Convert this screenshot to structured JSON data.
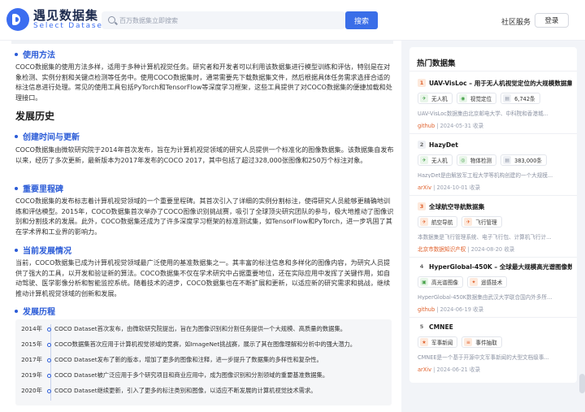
{
  "header": {
    "logo_cn": "遇见数据集",
    "logo_en": "Select Dataset",
    "search_placeholder": "百万数据集立即搜索",
    "search_button": "搜索",
    "community": "社区服务",
    "login": "登录"
  },
  "main": {
    "usage_heading": "使用方法",
    "usage_text": "COCO数据集的使用方法多样，适用于多种计算机视觉任务。研究者和开发者可以利用该数据集进行模型训练和评估，特别是在对象检测、实例分割和关键点检测等任务中。使用COCO数据集时，通常需要先下载数据集文件，然后根据具体任务需求选择合适的标注信息进行处理。常见的使用工具包括PyTorch和TensorFlow等深度学习框架，这些工具提供了对COCO数据集的便捷加载和处理接口。",
    "history_heading": "发展历史",
    "creation_heading": "创建时间与更新",
    "creation_text": "COCO数据集由微软研究院于2014年首次发布，旨在为计算机视觉领域的研究人员提供一个标准化的图像数据集。该数据集自发布以来，经历了多次更新，最新版本为2017年发布的COCO 2017，其中包括了超过328,000张图像和250万个标注对象。",
    "milestone_heading": "重要里程碑",
    "milestone_text": "COCO数据集的发布标志着计算机视觉领域的一个重要里程碑。其首次引入了详细的实例分割标注，使得研究人员能够更精确地训练和评估模型。2015年，COCO数据集首次举办了COCO图像识别挑战赛，吸引了全球顶尖研究团队的参与，极大地推动了图像识别和分割技术的发展。此外，COCO数据集还成为了许多深度学习框架的标准测试集，如TensorFlow和PyTorch，进一步巩固了其在学术界和工业界的影响力。",
    "current_heading": "当前发展情况",
    "current_text": "当前，COCO数据集已成为计算机视觉领域最广泛使用的基准数据集之一。其丰富的标注信息和多样化的图像内容，为研究人员提供了强大的工具，以开发和验证新的算法。COCO数据集不仅在学术研究中占据重要地位，还在实际应用中发挥了关键作用，如自动驾驶、医学影像分析和智能监控系统。随着技术的进步，COCO数据集也在不断扩展和更新，以适应新的研究需求和挑战，继续推动计算机视觉领域的创新和发展。",
    "timeline_heading": "发展历程",
    "timeline": [
      {
        "year": "2014年",
        "text": "COCO Dataset首次发布，由微软研究院提出，旨在为图像识别和分割任务提供一个大规模、高质量的数据集。"
      },
      {
        "year": "2015年",
        "text": "COCO数据集首次应用于计算机视觉领域的竞赛，如ImageNet挑战赛，展示了其在图像理解和分析中的强大潜力。"
      },
      {
        "year": "2017年",
        "text": "COCO Dataset发布了新的版本，增加了更多的图像和注释，进一步提升了数据集的多样性和复杂性。"
      },
      {
        "year": "2019年",
        "text": "COCO Dataset被广泛应用于多个研究项目和商业应用中，成为图像识别和分割领域的重要基准数据集。"
      },
      {
        "year": "2020年",
        "text": "COCO Dataset继续更新，引入了更多的标注类别和图像，以适应不断发展的计算机视觉技术需求。"
      }
    ]
  },
  "sidebar": {
    "title": "热门数据集",
    "items": [
      {
        "rank": "1",
        "rank_bg": "#fde9dc",
        "rank_fg": "#e0602b",
        "title": "UAV-VisLoc – 用于无人机视觉定位的大规模数据集",
        "tags": [
          {
            "icon": "drone-icon",
            "color": "#e8f5e9",
            "ico_color": "#43a047",
            "label": "无人机"
          },
          {
            "icon": "eye-icon",
            "color": "#e8f5e9",
            "ico_color": "#43a047",
            "label": "视觉定位"
          },
          {
            "icon": "storage-icon",
            "color": "#eef0f4",
            "ico_color": "#8c93a3",
            "label": "6,742条"
          }
        ],
        "desc": "UAV-VisLoc数据集由北京邮电大学、中科院和香港城...",
        "source": "github",
        "date": "2024-05-31",
        "views": "收录"
      },
      {
        "rank": "2",
        "rank_bg": "#eef0f4",
        "rank_fg": "#666",
        "title": "HazyDet",
        "tags": [
          {
            "icon": "drone-icon",
            "color": "#e8f5e9",
            "ico_color": "#43a047",
            "label": "无人机"
          },
          {
            "icon": "target-icon",
            "color": "#e8f5e9",
            "ico_color": "#43a047",
            "label": "物体检测"
          },
          {
            "icon": "storage-icon",
            "color": "#eef0f4",
            "ico_color": "#8c93a3",
            "label": "383,000条"
          }
        ],
        "desc": "HazyDet是由解放军工程大学等机构创建的一个大规模...",
        "source": "arXiv",
        "date": "2024-10-01",
        "views": "收录"
      },
      {
        "rank": "3",
        "rank_bg": "#fde9dc",
        "rank_fg": "#e0602b",
        "title": "全球航空导航数据集",
        "tags": [
          {
            "icon": "plane-icon",
            "color": "#fde9dc",
            "ico_color": "#e0602b",
            "label": "航空导航"
          },
          {
            "icon": "plane-icon",
            "color": "#fde9dc",
            "ico_color": "#e0602b",
            "label": "飞行管理"
          }
        ],
        "desc": "本数据集是飞行管理系统、电子飞行包、计算机飞行计...",
        "source": "北京市数据知识产权",
        "date": "2024-08-20",
        "views": "收录"
      },
      {
        "rank": "4",
        "rank_bg": "#ffffff",
        "rank_fg": "#666",
        "title": "HyperGlobal-450K – 全球最大规模高光谱图像数据集",
        "tags": [
          {
            "icon": "camera-icon",
            "color": "#e8f5e9",
            "ico_color": "#43a047",
            "label": "高光谱图像"
          },
          {
            "icon": "satellite-icon",
            "color": "#fde9dc",
            "ico_color": "#e0602b",
            "label": "遥感技术"
          }
        ],
        "desc": "HyperGlobal-450K数据集由武汉大学联合国内外多所...",
        "source": "github",
        "date": "2024-06-19",
        "views": "收录"
      },
      {
        "rank": "5",
        "rank_bg": "#ffffff",
        "rank_fg": "#666",
        "title": "CMNEE",
        "tags": [
          {
            "icon": "military-icon",
            "color": "#fde9dc",
            "ico_color": "#e0602b",
            "label": "军事新闻"
          },
          {
            "icon": "extract-icon",
            "color": "#fde9dc",
            "ico_color": "#e0602b",
            "label": "事件抽取"
          }
        ],
        "desc": "CMNEE是一个基于开源中文军事新闻的大型文档级事...",
        "source": "arXiv",
        "date": "2024-06-21",
        "views": "收录"
      }
    ]
  }
}
